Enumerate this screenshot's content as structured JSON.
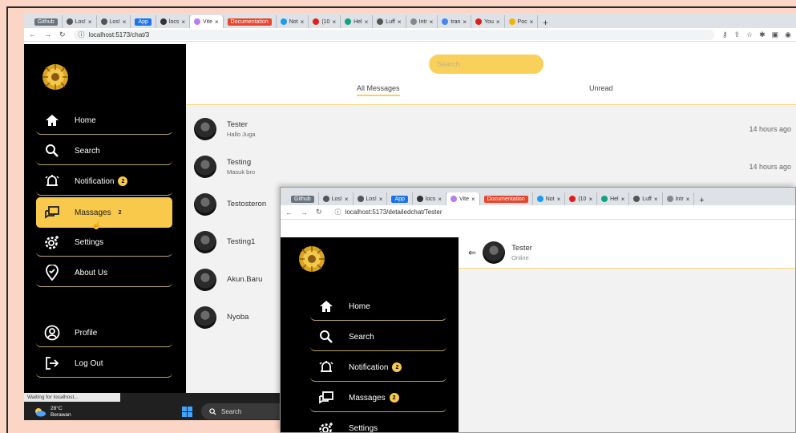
{
  "window1": {
    "tabs": [
      {
        "label": "Github",
        "pill": "#6a737d"
      },
      {
        "label": "Los!",
        "fav": "#555"
      },
      {
        "label": "Los!",
        "fav": "#555"
      },
      {
        "label": "App",
        "pill": "#1a73e8"
      },
      {
        "label": "locs",
        "fav": "#333"
      },
      {
        "label": "Vite",
        "fav": "#b67cf2",
        "active": true
      },
      {
        "label": "Documentation",
        "pill": "#e8452c"
      },
      {
        "label": "Not",
        "fav": "#1d9bf0"
      },
      {
        "label": "(10",
        "fav": "#e01e1e"
      },
      {
        "label": "Hel",
        "fav": "#10a37f"
      },
      {
        "label": "Luff",
        "fav": "#555"
      },
      {
        "label": "Intr",
        "fav": "#888"
      },
      {
        "label": "tran",
        "fav": "#4285f4"
      },
      {
        "label": "You",
        "fav": "#e01e1e"
      },
      {
        "label": "Poc",
        "fav": "#f4b400"
      }
    ],
    "url": "localhost:5173/chat/3",
    "nav": {
      "home": "Home",
      "search": "Search",
      "notification": "Notification",
      "notification_badge": "2",
      "messages": "Massages",
      "messages_badge": "2",
      "settings": "Settings",
      "about": "About Us",
      "profile": "Profile",
      "logout": "Log Out"
    },
    "search_placeholder": "Search",
    "tab_all": "All Messages",
    "tab_unread": "Unread",
    "chats": [
      {
        "name": "Tester",
        "message": "Hallo Juga",
        "time": "14 hours ago"
      },
      {
        "name": "Testing",
        "message": "Masuk bro",
        "time": "14 hours ago"
      },
      {
        "name": "Testosteron",
        "message": "",
        "time": ""
      },
      {
        "name": "Testing1",
        "message": "",
        "time": ""
      },
      {
        "name": "Akun.Baru",
        "message": "",
        "time": ""
      },
      {
        "name": "Nyoba",
        "message": "",
        "time": ""
      }
    ],
    "status_bar": "Waiting for localhost...",
    "weather_temp": "28°C",
    "weather_desc": "Berawan",
    "taskbar_search": "Search"
  },
  "window2": {
    "tabs": [
      {
        "label": "Github",
        "pill": "#6a737d"
      },
      {
        "label": "Los!",
        "fav": "#555"
      },
      {
        "label": "Los!",
        "fav": "#555"
      },
      {
        "label": "App",
        "pill": "#1a73e8"
      },
      {
        "label": "locs",
        "fav": "#333"
      },
      {
        "label": "Vite",
        "fav": "#b67cf2",
        "active": true
      },
      {
        "label": "Documentation",
        "pill": "#e8452c"
      },
      {
        "label": "Not",
        "fav": "#1d9bf0"
      },
      {
        "label": "(10",
        "fav": "#e01e1e"
      },
      {
        "label": "Hel",
        "fav": "#10a37f"
      },
      {
        "label": "Luff",
        "fav": "#555"
      },
      {
        "label": "Intr",
        "fav": "#888"
      }
    ],
    "url": "localhost:5173/detailedchat/Tester",
    "contact_name": "Tester",
    "contact_status": "Online",
    "nav": {
      "home": "Home",
      "search": "Search",
      "notification": "Notification",
      "notification_badge": "2",
      "messages": "Massages",
      "messages_badge": "2",
      "settings": "Settings"
    }
  },
  "colors": {
    "accent": "#f8c94a",
    "sidebar": "#000000",
    "underline": "#b9a86a"
  }
}
